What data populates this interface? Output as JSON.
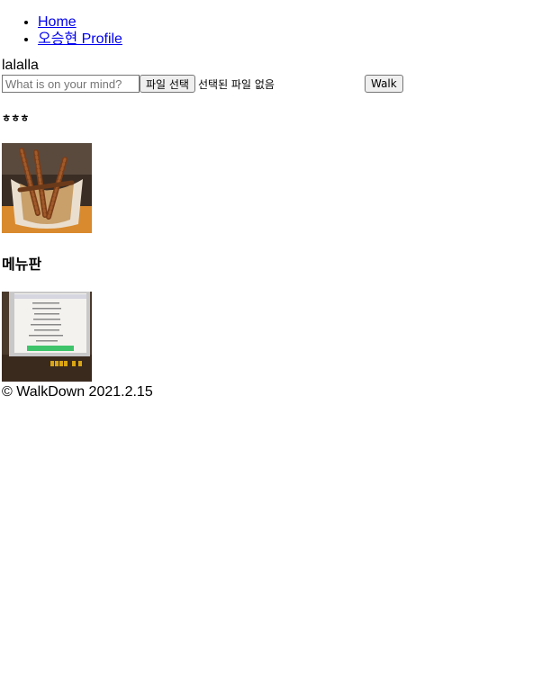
{
  "nav": {
    "items": [
      {
        "label": "Home"
      },
      {
        "label": "오승현 Profile"
      }
    ]
  },
  "user": {
    "name": "lalalla"
  },
  "form": {
    "input_placeholder": "What is on your mind?",
    "file_button_label": "파일 선택",
    "file_status": "선택된 파일 없음",
    "submit_label": "Walk"
  },
  "posts": [
    {
      "title": "ㅎㅎㅎ",
      "image": "food-photo"
    },
    {
      "title": "메뉴판",
      "image": "menu-board-photo"
    }
  ],
  "footer": {
    "text": "© WalkDown 2021.2.15"
  }
}
